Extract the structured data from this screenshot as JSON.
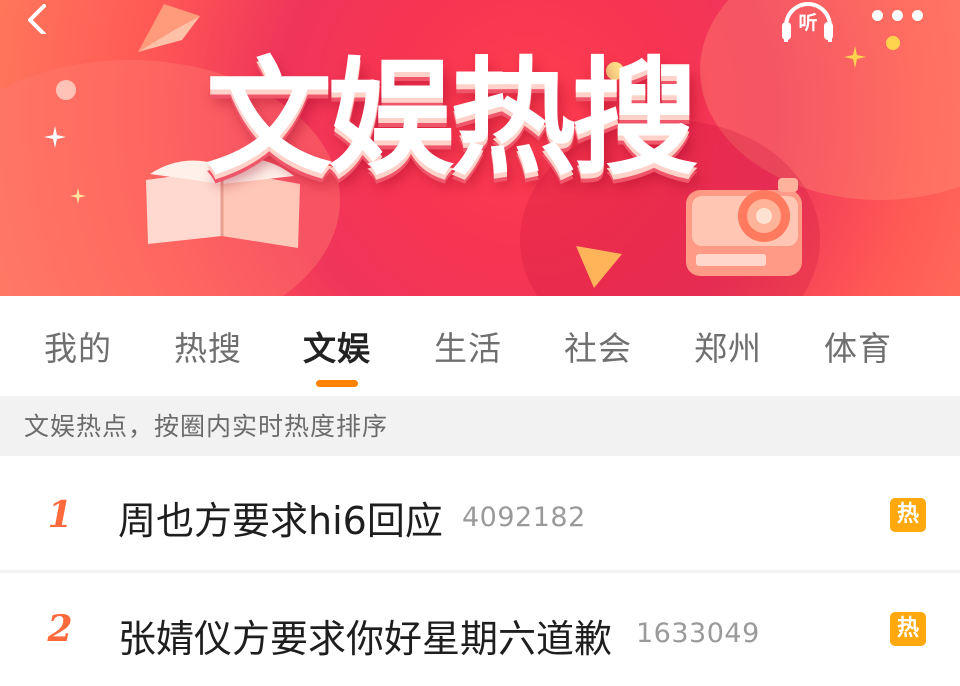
{
  "header": {
    "title": "文娱热搜",
    "listen_label": "听",
    "back_icon": "chevron-left-icon",
    "more_icon": "more-dots-icon"
  },
  "tabs": [
    {
      "label": "我的",
      "active": false
    },
    {
      "label": "热搜",
      "active": false
    },
    {
      "label": "文娱",
      "active": true
    },
    {
      "label": "生活",
      "active": false
    },
    {
      "label": "社会",
      "active": false
    },
    {
      "label": "郑州",
      "active": false
    },
    {
      "label": "体育",
      "active": false
    }
  ],
  "subheader": "文娱热点，按圈内实时热度排序",
  "list": [
    {
      "rank": "1",
      "topic": "周也方要求hi6回应",
      "count": "4092182",
      "badge": "热"
    },
    {
      "rank": "2",
      "topic": "张婧仪方要求你好星期六道歉",
      "count": "1633049",
      "badge": "热"
    }
  ],
  "colors": {
    "accent": "#ff8200",
    "rank": "#ff6a3d",
    "hot_badge": "#ffa90f",
    "banner": "#f73552"
  }
}
